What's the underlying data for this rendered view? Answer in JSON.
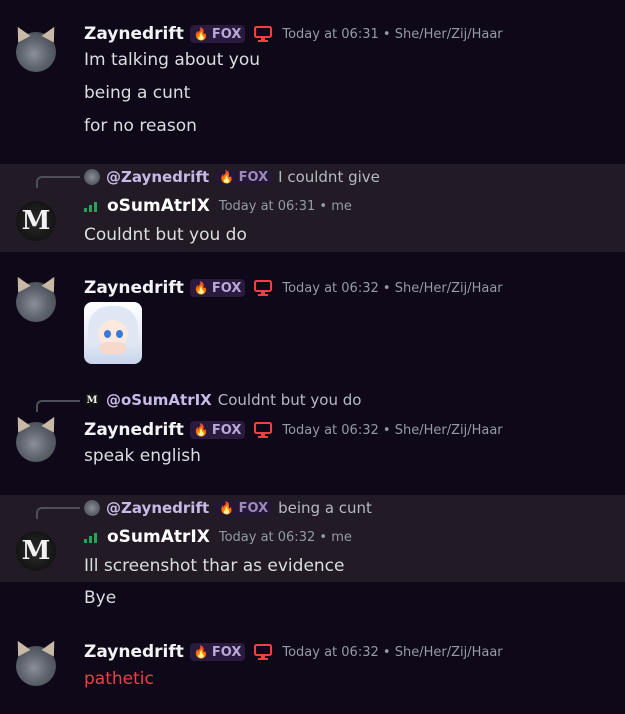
{
  "users": {
    "zayne": {
      "name": "Zaynedrift",
      "tag": "FOX",
      "pronouns": "She/Her/Zij/Haar"
    },
    "osum": {
      "name": "oSumAtrIX",
      "suffix": "me"
    }
  },
  "messages": [
    {
      "author": "Zaynedrift",
      "tag": "FOX",
      "time": "Today at 06:31",
      "meta": "She/Her/Zij/Haar",
      "lines": [
        "Im talking about you",
        "being a cunt",
        "for no reason"
      ]
    },
    {
      "reply_to": {
        "name": "@Zaynedrift",
        "tag": "FOX",
        "text": "I couldnt give"
      },
      "author": "oSumAtrIX",
      "time": "Today at 06:31",
      "meta": "me",
      "lines": [
        "Couldnt but you do"
      ]
    },
    {
      "author": "Zaynedrift",
      "tag": "FOX",
      "time": "Today at 06:32",
      "meta": "She/Her/Zij/Haar",
      "sticker": "anime-girl-sticker"
    },
    {
      "reply_to": {
        "name": "@oSumAtrIX",
        "text": "Couldnt but you do"
      },
      "author": "Zaynedrift",
      "tag": "FOX",
      "time": "Today at 06:32",
      "meta": "She/Her/Zij/Haar",
      "lines": [
        "speak english"
      ]
    },
    {
      "reply_to": {
        "name": "@Zaynedrift",
        "tag": "FOX",
        "text": "being a cunt"
      },
      "author": "oSumAtrIX",
      "time": "Today at 06:32",
      "meta": "me",
      "lines": [
        "Ill screenshot thar as evidence",
        "Bye"
      ]
    },
    {
      "author": "Zaynedrift",
      "tag": "FOX",
      "time": "Today at 06:32",
      "meta": "She/Her/Zij/Haar",
      "lines": [
        "pathetic"
      ]
    }
  ],
  "separator": "•",
  "icons": {
    "badge": "flame-icon",
    "device": "monitor-icon",
    "status": "signal-icon"
  },
  "colors": {
    "background": "#0f0818",
    "highlight": "#221a24",
    "danger_text": "#f23f43",
    "device_icon": "#f23f43",
    "signal": "#23a55a"
  }
}
